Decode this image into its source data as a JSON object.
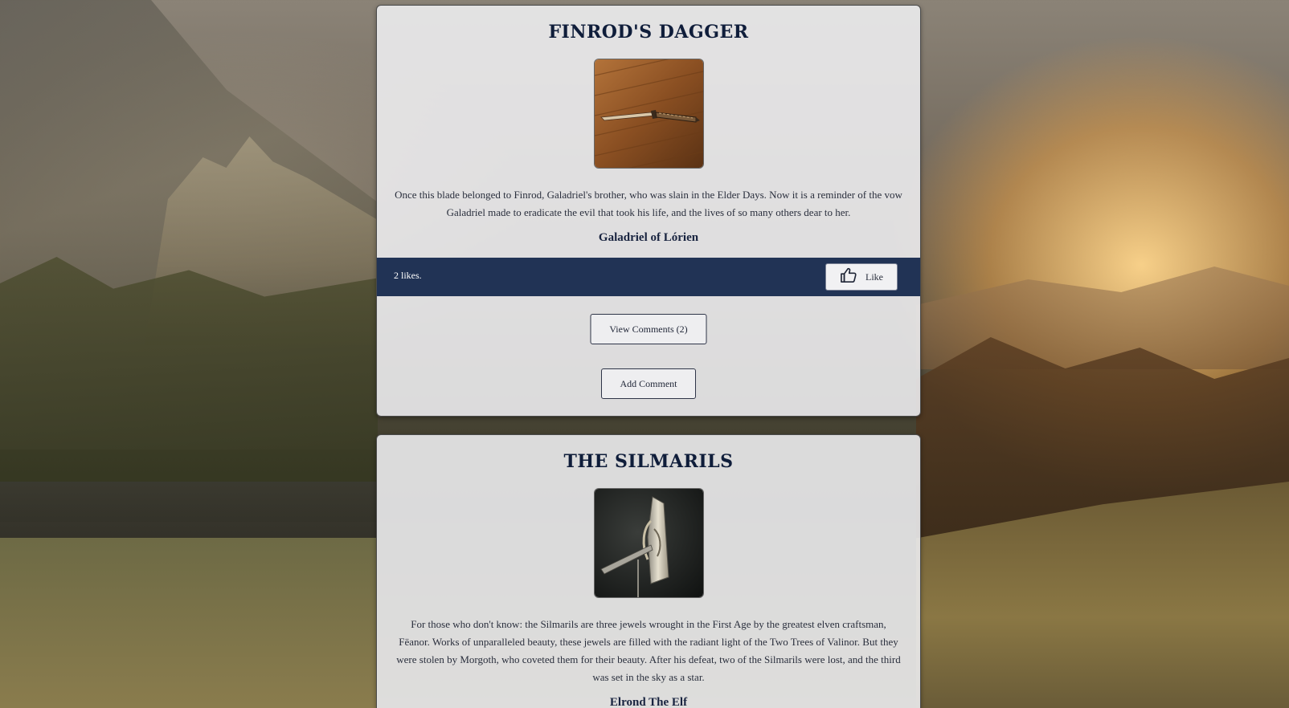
{
  "posts": [
    {
      "title": "FINROD'S DAGGER",
      "image_alt": "Dagger lying on a wooden surface",
      "description": "Once this blade belonged to Finrod, Galadriel's brother, who was slain in the Elder Days. Now it is a reminder of the vow Galadriel made to eradicate the evil that took his life, and the lives of so many others dear to her.",
      "author": "Galadriel of Lórien",
      "likes_text": "2 likes.",
      "like_label": "Like",
      "like_icon": "thumbs-up-icon",
      "view_comments_label": "View Comments (2)",
      "add_comment_label": "Add Comment"
    },
    {
      "title": "THE SILMARILS",
      "image_alt": "Ornate silver relic against a dark background",
      "description": "For those who don't know: the Silmarils are three jewels wrought in the First Age by the greatest elven craftsman, Fëanor. Works of unparalleled beauty, these jewels are filled with the radiant light of the Two Trees of Valinor. But they were stolen by Morgoth, who coveted them for their beauty. After his defeat, two of the Silmarils were lost, and the third was set in the sky as a star.",
      "author": "Elrond The Elf"
    }
  ],
  "colors": {
    "title": "#0f1d3a",
    "like_bar": "#213355",
    "card_bg": "#ececee"
  }
}
